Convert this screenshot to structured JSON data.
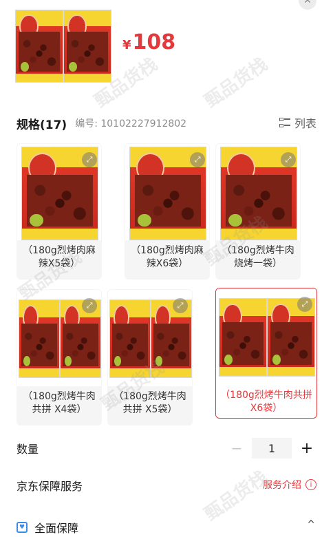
{
  "price": {
    "currency": "¥",
    "amount": "108"
  },
  "spec": {
    "title": "规格(17)",
    "code": "编号: 10102227912802",
    "list_label": "列表"
  },
  "options": [
    {
      "label": "（180g烈烤肉麻辣X5袋）",
      "selected": false
    },
    {
      "label": "（180g烈烤肉麻辣X6袋）",
      "selected": false
    },
    {
      "label": "（180g烈烤牛肉烧烤一袋）",
      "selected": false
    },
    {
      "label": "（180g烈烤牛肉共拼 X4袋）",
      "selected": false
    },
    {
      "label": "（180g烈烤牛肉共拼 X5袋）",
      "selected": false
    },
    {
      "label": "（180g烈烤牛肉共拼 X6袋）",
      "selected": true
    }
  ],
  "quantity": {
    "label": "数量",
    "value": "1",
    "minus": "−",
    "plus": "+"
  },
  "service": {
    "label": "京东保障服务",
    "link": "服务介绍",
    "info": "i"
  },
  "guarantee": {
    "label": "全面保障"
  },
  "watermark": "甄品货栈",
  "colors": {
    "accent": "#e4393c",
    "shield": "#3d8be8"
  }
}
